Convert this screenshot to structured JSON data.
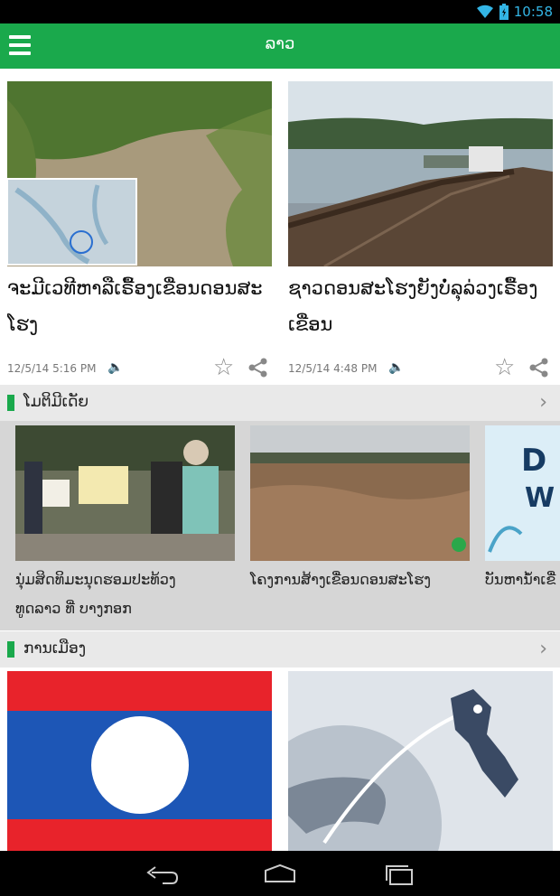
{
  "statusbar": {
    "time": "10:58"
  },
  "appbar": {
    "title": "ລາວ"
  },
  "featured": [
    {
      "headline": "ຈະມີເວທີຫາລືເຣື້ອງເຂື່ອນດອນສະໂຮງ",
      "timestamp": "12/5/14  5:16  PM"
    },
    {
      "headline": "ຊາວດອນສະໂຮງຍັງບໍ່ລຸລ່ວງເຣື້ອງ  ເຂື່ອນ",
      "timestamp": "12/5/14  4:48  PM"
    }
  ],
  "sections": [
    {
      "title": "ໂມຕິມີເດັຍ"
    },
    {
      "title": "ການເມືອງ"
    }
  ],
  "multimedia": [
    {
      "caption_line1": "ນຸ່ມສິດທິມະນຸດຮອມປະທ້ວງ",
      "caption_line2": "ທູດລາວ  ທີ່  ບາງກອກ"
    },
    {
      "caption_line1": "ໂຄງການສ້າງເຂື່ອນດອນສະໂຮງ",
      "caption_line2": ""
    },
    {
      "caption_line1": "ບັນຫານ້ຳເຂື່",
      "caption_line2": ""
    }
  ],
  "icons": {
    "menu": "hamburger-icon",
    "wifi": "wifi-icon",
    "battery": "battery-icon",
    "audio": "speaker-icon",
    "favorite": "star-icon",
    "share": "share-icon",
    "chevron": "chevron-right-icon",
    "back": "back-icon",
    "home": "home-icon",
    "recents": "recents-icon"
  },
  "colors": {
    "brand": "#1aa94c"
  }
}
